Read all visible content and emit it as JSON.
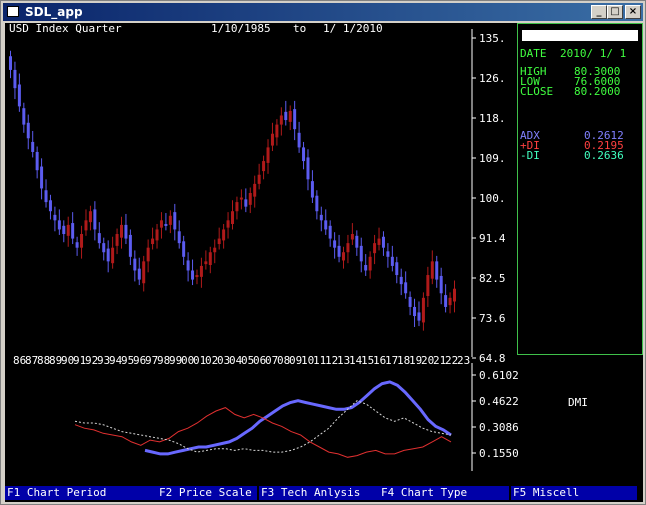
{
  "window": {
    "title": "SDL_app",
    "min_glyph": "_",
    "max_glyph": "□",
    "close_glyph": "×"
  },
  "header": {
    "symbol": "USD Index Quarter",
    "from": "1/10/1985",
    "to_word": "to",
    "to": "1/ 1/2010"
  },
  "info": {
    "date_label": "DATE",
    "date_value": "2010/ 1/ 1",
    "high_label": "HIGH",
    "high_value": "80.3000",
    "low_label": "LOW",
    "low_value": "76.6000",
    "close_label": "CLOSE",
    "close_value": "80.2000",
    "adx_label": "ADX",
    "adx_value": "0.2612",
    "pdi_label": "+DI",
    "pdi_value": "0.2195",
    "mdi_label": "-DI",
    "mdi_value": "0.2636"
  },
  "indicator_label": "DMI",
  "function_keys": [
    "F1 Chart Period",
    "F2 Price Scale",
    "F3 Tech Anlysis",
    "F4 Chart Type",
    "F5 Miscell"
  ],
  "colors": {
    "up": "#b01a1a",
    "down": "#5c5cf0",
    "adx": "#6868ff",
    "pdi": "#e03030",
    "mdi": "#d8d8d8",
    "panel_border": "#3fc04a",
    "panel_text": "#40ff40"
  },
  "chart_data": [
    {
      "type": "candlestick",
      "title": "",
      "y_ticks": [
        "135.",
        "126.",
        "118.",
        "109.",
        "100.",
        "91.4",
        "82.5",
        "73.6",
        "64.8"
      ],
      "ylim": [
        64.8,
        135.0
      ],
      "close": [
        128,
        124,
        120,
        116,
        113,
        110,
        106,
        102,
        99,
        97,
        95,
        93,
        92,
        94,
        91,
        89,
        92,
        95,
        97,
        93,
        90,
        88,
        86,
        89,
        92,
        94,
        91,
        87,
        84,
        82,
        86,
        89,
        91,
        93,
        95,
        94,
        96,
        93,
        90,
        87,
        84,
        82,
        83,
        85,
        86,
        88,
        89,
        91,
        93,
        95,
        97,
        99,
        100,
        98,
        101,
        103,
        105,
        108,
        111,
        114,
        116,
        118,
        117,
        119,
        115,
        111,
        108,
        104,
        100,
        97,
        95,
        93,
        91,
        89,
        87,
        88,
        90,
        92,
        89,
        86,
        84,
        87,
        90,
        91,
        89,
        87,
        85,
        83,
        81,
        79,
        76,
        74,
        73,
        78,
        83,
        86,
        82,
        79,
        76,
        78,
        80
      ]
    },
    {
      "type": "line",
      "title": "DMI",
      "y_ticks": [
        "0.6102",
        "0.4622",
        "0.3086",
        "0.1550"
      ],
      "ylim": [
        0.155,
        0.6102
      ],
      "series": [
        {
          "name": "ADX",
          "values": [
            0.17,
            0.16,
            0.15,
            0.15,
            0.16,
            0.17,
            0.18,
            0.19,
            0.19,
            0.2,
            0.21,
            0.22,
            0.24,
            0.27,
            0.3,
            0.34,
            0.37,
            0.4,
            0.43,
            0.45,
            0.46,
            0.45,
            0.44,
            0.43,
            0.42,
            0.41,
            0.41,
            0.42,
            0.45,
            0.49,
            0.53,
            0.56,
            0.57,
            0.55,
            0.51,
            0.46,
            0.41,
            0.35,
            0.31,
            0.29,
            0.26
          ]
        },
        {
          "name": "+DI",
          "values": [
            0.32,
            0.3,
            0.29,
            0.27,
            0.26,
            0.25,
            0.22,
            0.2,
            0.23,
            0.22,
            0.24,
            0.28,
            0.3,
            0.33,
            0.37,
            0.4,
            0.42,
            0.38,
            0.36,
            0.38,
            0.36,
            0.33,
            0.31,
            0.28,
            0.26,
            0.22,
            0.19,
            0.16,
            0.15,
            0.13,
            0.14,
            0.16,
            0.17,
            0.15,
            0.15,
            0.17,
            0.18,
            0.19,
            0.22,
            0.25,
            0.22
          ]
        },
        {
          "name": "-DI",
          "values": [
            0.34,
            0.33,
            0.33,
            0.32,
            0.3,
            0.28,
            0.27,
            0.26,
            0.25,
            0.24,
            0.23,
            0.21,
            0.18,
            0.16,
            0.17,
            0.18,
            0.18,
            0.17,
            0.18,
            0.17,
            0.17,
            0.16,
            0.16,
            0.17,
            0.19,
            0.22,
            0.26,
            0.3,
            0.36,
            0.41,
            0.46,
            0.44,
            0.4,
            0.36,
            0.34,
            0.36,
            0.33,
            0.3,
            0.28,
            0.27,
            0.26
          ]
        }
      ]
    }
  ]
}
